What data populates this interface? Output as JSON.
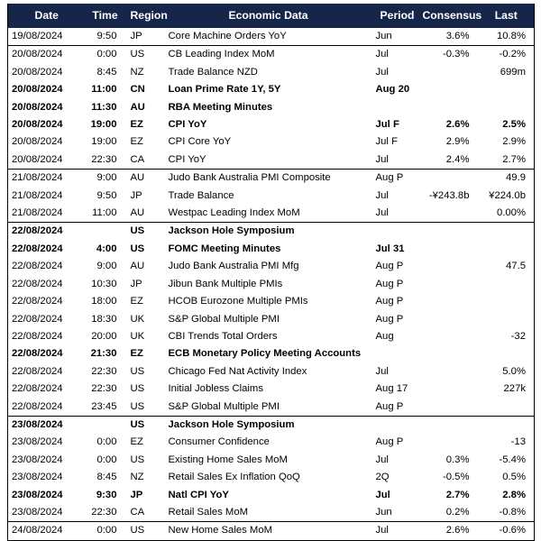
{
  "table": {
    "columns": [
      {
        "key": "date",
        "label": "Date",
        "align": "left"
      },
      {
        "key": "time",
        "label": "Time",
        "align": "right"
      },
      {
        "key": "region",
        "label": "Region",
        "align": "left"
      },
      {
        "key": "data",
        "label": "Economic Data",
        "align": "left"
      },
      {
        "key": "period",
        "label": "Period",
        "align": "left"
      },
      {
        "key": "consensus",
        "label": "Consensus",
        "align": "right"
      },
      {
        "key": "last",
        "label": "Last",
        "align": "right"
      }
    ],
    "header_background": "#16264a",
    "header_text_color": "#ffffff",
    "rows": [
      {
        "date": "19/08/2024",
        "time": "9:50",
        "region": "JP",
        "data": "Core Machine Orders YoY",
        "period": "Jun",
        "consensus": "3.6%",
        "last": "10.8%",
        "bold": false,
        "group_start": false
      },
      {
        "date": "20/08/2024",
        "time": "0:00",
        "region": "US",
        "data": "CB Leading Index MoM",
        "period": "Jul",
        "consensus": "-0.3%",
        "last": "-0.2%",
        "bold": false,
        "group_start": true
      },
      {
        "date": "20/08/2024",
        "time": "8:45",
        "region": "NZ",
        "data": "Trade Balance NZD",
        "period": "Jul",
        "consensus": "",
        "last": "699m",
        "bold": false,
        "group_start": false
      },
      {
        "date": "20/08/2024",
        "time": "11:00",
        "region": "CN",
        "data": "Loan Prime Rate 1Y, 5Y",
        "period": "Aug 20",
        "consensus": "",
        "last": "",
        "bold": true,
        "group_start": false
      },
      {
        "date": "20/08/2024",
        "time": "11:30",
        "region": "AU",
        "data": "RBA Meeting Minutes",
        "period": "",
        "consensus": "",
        "last": "",
        "bold": true,
        "group_start": false
      },
      {
        "date": "20/08/2024",
        "time": "19:00",
        "region": "EZ",
        "data": "CPI YoY",
        "period": "Jul F",
        "consensus": "2.6%",
        "last": "2.5%",
        "bold": true,
        "group_start": false
      },
      {
        "date": "20/08/2024",
        "time": "19:00",
        "region": "EZ",
        "data": "CPI Core YoY",
        "period": "Jul F",
        "consensus": "2.9%",
        "last": "2.9%",
        "bold": false,
        "group_start": false
      },
      {
        "date": "20/08/2024",
        "time": "22:30",
        "region": "CA",
        "data": "CPI YoY",
        "period": "Jul",
        "consensus": "2.4%",
        "last": "2.7%",
        "bold": false,
        "group_start": false
      },
      {
        "date": "21/08/2024",
        "time": "9:00",
        "region": "AU",
        "data": "Judo Bank Australia PMI Composite",
        "period": "Aug P",
        "consensus": "",
        "last": "49.9",
        "bold": false,
        "group_start": true
      },
      {
        "date": "21/08/2024",
        "time": "9:50",
        "region": "JP",
        "data": "Trade Balance",
        "period": "Jul",
        "consensus": "-¥243.8b",
        "last": "¥224.0b",
        "bold": false,
        "group_start": false
      },
      {
        "date": "21/08/2024",
        "time": "11:00",
        "region": "AU",
        "data": "Westpac Leading Index MoM",
        "period": "Jul",
        "consensus": "",
        "last": "0.00%",
        "bold": false,
        "group_start": false
      },
      {
        "date": "22/08/2024",
        "time": "",
        "region": "US",
        "data": "Jackson Hole Symposium",
        "period": "",
        "consensus": "",
        "last": "",
        "bold": true,
        "group_start": true
      },
      {
        "date": "22/08/2024",
        "time": "4:00",
        "region": "US",
        "data": "FOMC Meeting Minutes",
        "period": "Jul 31",
        "consensus": "",
        "last": "",
        "bold": true,
        "group_start": false
      },
      {
        "date": "22/08/2024",
        "time": "9:00",
        "region": "AU",
        "data": "Judo Bank Australia PMI Mfg",
        "period": "Aug P",
        "consensus": "",
        "last": "47.5",
        "bold": false,
        "group_start": false
      },
      {
        "date": "22/08/2024",
        "time": "10:30",
        "region": "JP",
        "data": "Jibun Bank Multiple PMIs",
        "period": "Aug P",
        "consensus": "",
        "last": "",
        "bold": false,
        "group_start": false
      },
      {
        "date": "22/08/2024",
        "time": "18:00",
        "region": "EZ",
        "data": "HCOB Eurozone Multiple PMIs",
        "period": "Aug P",
        "consensus": "",
        "last": "",
        "bold": false,
        "group_start": false
      },
      {
        "date": "22/08/2024",
        "time": "18:30",
        "region": "UK",
        "data": "S&P Global Multiple PMI",
        "period": "Aug P",
        "consensus": "",
        "last": "",
        "bold": false,
        "group_start": false
      },
      {
        "date": "22/08/2024",
        "time": "20:00",
        "region": "UK",
        "data": "CBI Trends Total Orders",
        "period": "Aug",
        "consensus": "",
        "last": "-32",
        "bold": false,
        "group_start": false
      },
      {
        "date": "22/08/2024",
        "time": "21:30",
        "region": "EZ",
        "data": "ECB Monetary Policy Meeting Accounts",
        "period": "",
        "consensus": "",
        "last": "",
        "bold": true,
        "group_start": false
      },
      {
        "date": "22/08/2024",
        "time": "22:30",
        "region": "US",
        "data": "Chicago Fed Nat Activity Index",
        "period": "Jul",
        "consensus": "",
        "last": "5.0%",
        "bold": false,
        "group_start": false
      },
      {
        "date": "22/08/2024",
        "time": "22:30",
        "region": "US",
        "data": "Initial Jobless Claims",
        "period": "Aug 17",
        "consensus": "",
        "last": "227k",
        "bold": false,
        "group_start": false
      },
      {
        "date": "22/08/2024",
        "time": "23:45",
        "region": "US",
        "data": "S&P Global Multiple PMI",
        "period": "Aug P",
        "consensus": "",
        "last": "",
        "bold": false,
        "group_start": false
      },
      {
        "date": "23/08/2024",
        "time": "",
        "region": "US",
        "data": "Jackson Hole Symposium",
        "period": "",
        "consensus": "",
        "last": "",
        "bold": true,
        "group_start": true
      },
      {
        "date": "23/08/2024",
        "time": "0:00",
        "region": "EZ",
        "data": "Consumer Confidence",
        "period": "Aug P",
        "consensus": "",
        "last": "-13",
        "bold": false,
        "group_start": false
      },
      {
        "date": "23/08/2024",
        "time": "0:00",
        "region": "US",
        "data": "Existing Home Sales MoM",
        "period": "Jul",
        "consensus": "0.3%",
        "last": "-5.4%",
        "bold": false,
        "group_start": false
      },
      {
        "date": "23/08/2024",
        "time": "8:45",
        "region": "NZ",
        "data": "Retail Sales Ex Inflation QoQ",
        "period": "2Q",
        "consensus": "-0.5%",
        "last": "0.5%",
        "bold": false,
        "group_start": false
      },
      {
        "date": "23/08/2024",
        "time": "9:30",
        "region": "JP",
        "data": "Natl CPI YoY",
        "period": "Jul",
        "consensus": "2.7%",
        "last": "2.8%",
        "bold": true,
        "group_start": false
      },
      {
        "date": "23/08/2024",
        "time": "22:30",
        "region": "CA",
        "data": "Retail Sales MoM",
        "period": "Jun",
        "consensus": "0.2%",
        "last": "-0.8%",
        "bold": false,
        "group_start": false
      },
      {
        "date": "24/08/2024",
        "time": "0:00",
        "region": "US",
        "data": "New Home Sales MoM",
        "period": "Jul",
        "consensus": "2.6%",
        "last": "-0.6%",
        "bold": false,
        "group_start": true
      }
    ]
  }
}
